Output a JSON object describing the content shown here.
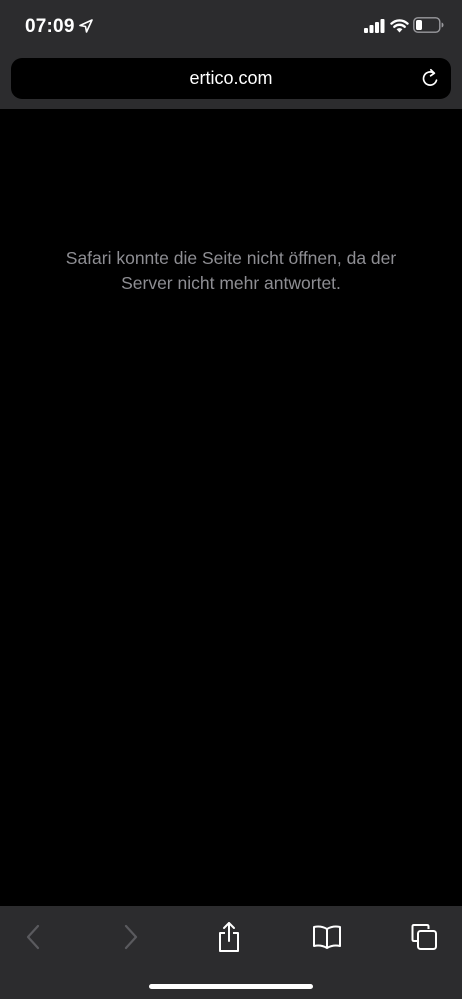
{
  "status_bar": {
    "time": "07:09",
    "location_icon": "location-arrow-icon",
    "signal_icon": "cellular-signal-icon",
    "wifi_icon": "wifi-icon",
    "battery_icon": "battery-icon",
    "battery_level": 0.25
  },
  "address_bar": {
    "url": "ertico.com",
    "reload_icon": "reload-icon"
  },
  "content": {
    "error_message": "Safari konnte die Seite nicht öffnen, da der Server nicht mehr antwortet."
  },
  "toolbar": {
    "back_icon": "chevron-left-icon",
    "forward_icon": "chevron-right-icon",
    "share_icon": "share-icon",
    "bookmarks_icon": "book-icon",
    "tabs_icon": "tabs-icon"
  },
  "colors": {
    "chrome_background": "#2c2c2e",
    "page_background": "#000000",
    "accent_icon": "#0a84ff",
    "message_text": "#8e8e93",
    "disabled_icon": "#5a5a5e"
  }
}
